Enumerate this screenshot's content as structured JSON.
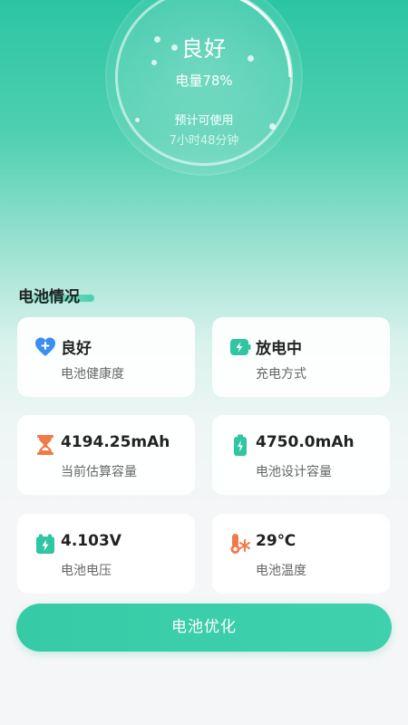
{
  "hero": {
    "status": "良好",
    "battery_level": "电量78%",
    "estimate_label": "预计可使用",
    "estimate_value": "7小时48分钟"
  },
  "section": {
    "title": "电池情况"
  },
  "cards": [
    {
      "value": "良好",
      "label": "电池健康度",
      "icon": "heart-icon",
      "color": "#3b8ff0"
    },
    {
      "value": "放电中",
      "label": "充电方式",
      "icon": "lightning-icon",
      "color": "#2fc6a1"
    },
    {
      "value": "4194.25mAh",
      "label": "当前估算容量",
      "icon": "hourglass-icon",
      "color": "#f07a4a"
    },
    {
      "value": "4750.0mAh",
      "label": "电池设计容量",
      "icon": "battery-icon",
      "color": "#2fc6a1"
    },
    {
      "value": "4.103V",
      "label": "电池电压",
      "icon": "voltage-icon",
      "color": "#2fc6a1"
    },
    {
      "value": "29℃",
      "label": "电池温度",
      "icon": "thermometer-icon",
      "color": "#f07a4a"
    }
  ],
  "button": {
    "label": "电池优化"
  },
  "colors": {
    "accent": "#36cba6",
    "text_primary": "#222222",
    "text_secondary": "#666666"
  }
}
